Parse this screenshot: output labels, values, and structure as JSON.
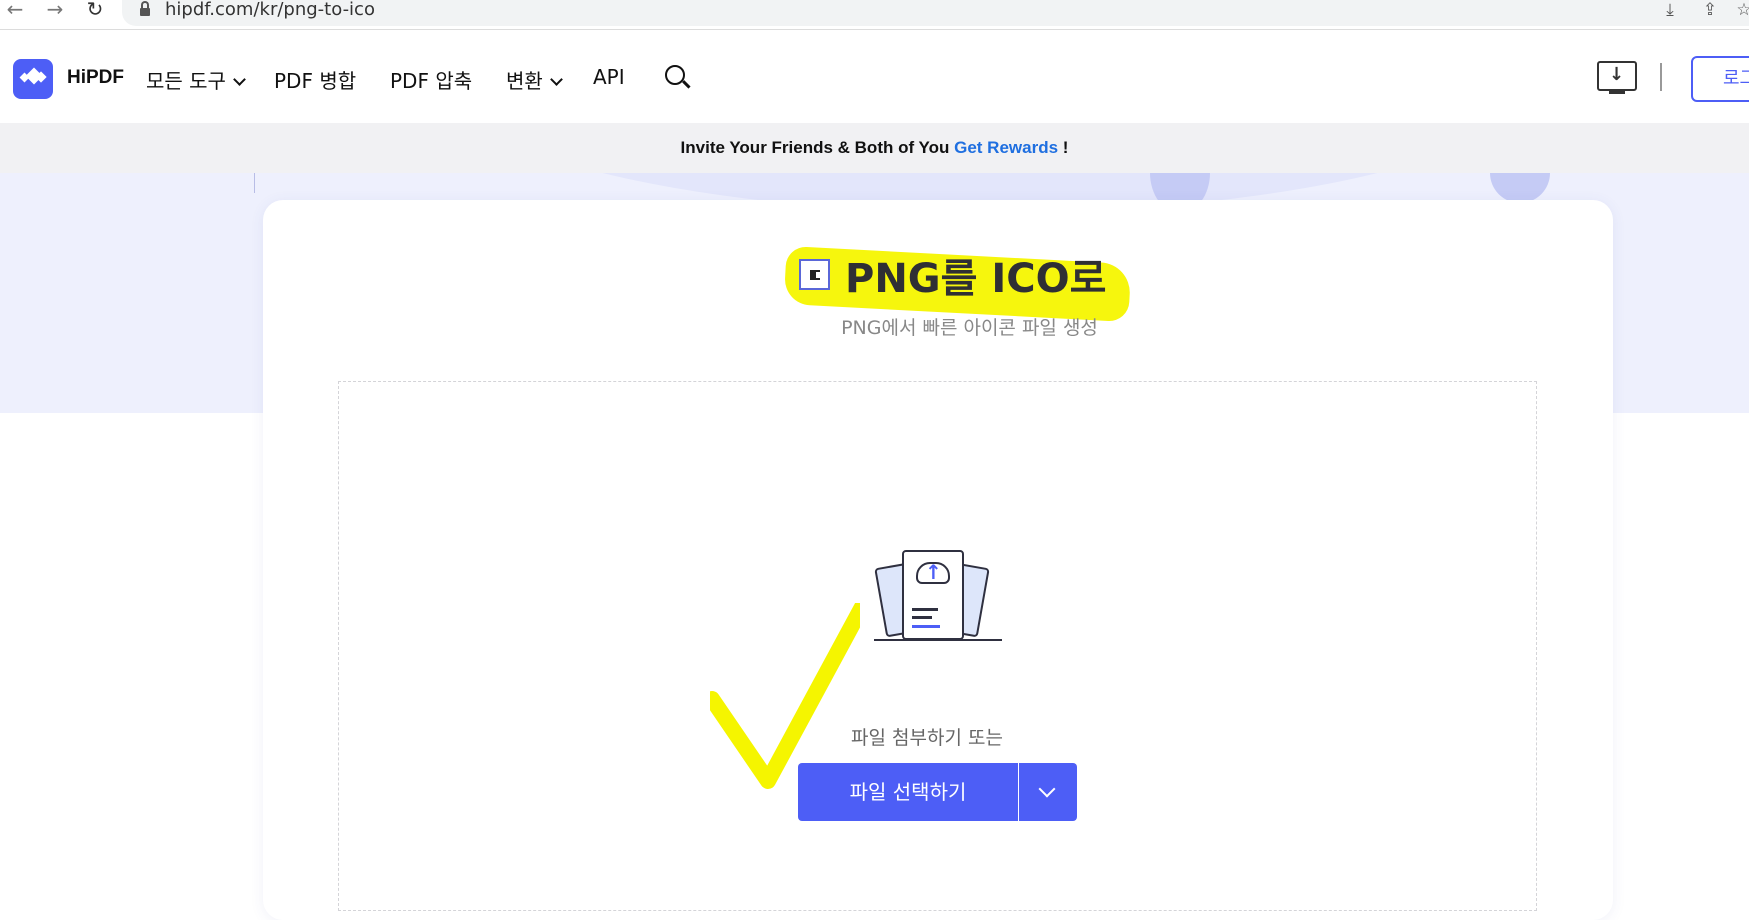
{
  "browser": {
    "url": "hipdf.com/kr/png-to-ico",
    "icons": [
      "back-arrow-icon",
      "forward-arrow-icon",
      "reload-icon",
      "lock-icon",
      "install-app-icon",
      "share-icon",
      "bookmark-star-icon"
    ]
  },
  "header": {
    "brand": "HiPDF",
    "nav": {
      "all_tools": "모든 도구",
      "merge": "PDF 병합",
      "compress": "PDF 압축",
      "convert": "변환",
      "api": "API"
    },
    "login_label": "로그"
  },
  "promo": {
    "text": "Invite Your Friends & Both of You ",
    "link": "Get Rewards",
    "suffix": " !"
  },
  "main": {
    "title": "PNG를 ICO로",
    "subtitle": "PNG에서 빠른 아이콘 파일 생성",
    "drop_text": "파일 첨부하기 또는",
    "choose_button": "파일 선택하기"
  },
  "colors": {
    "accent": "#4d5ef6",
    "link": "#1f6fe0",
    "highlight": "#f5f500",
    "hero_bg": "#eef0fd"
  }
}
